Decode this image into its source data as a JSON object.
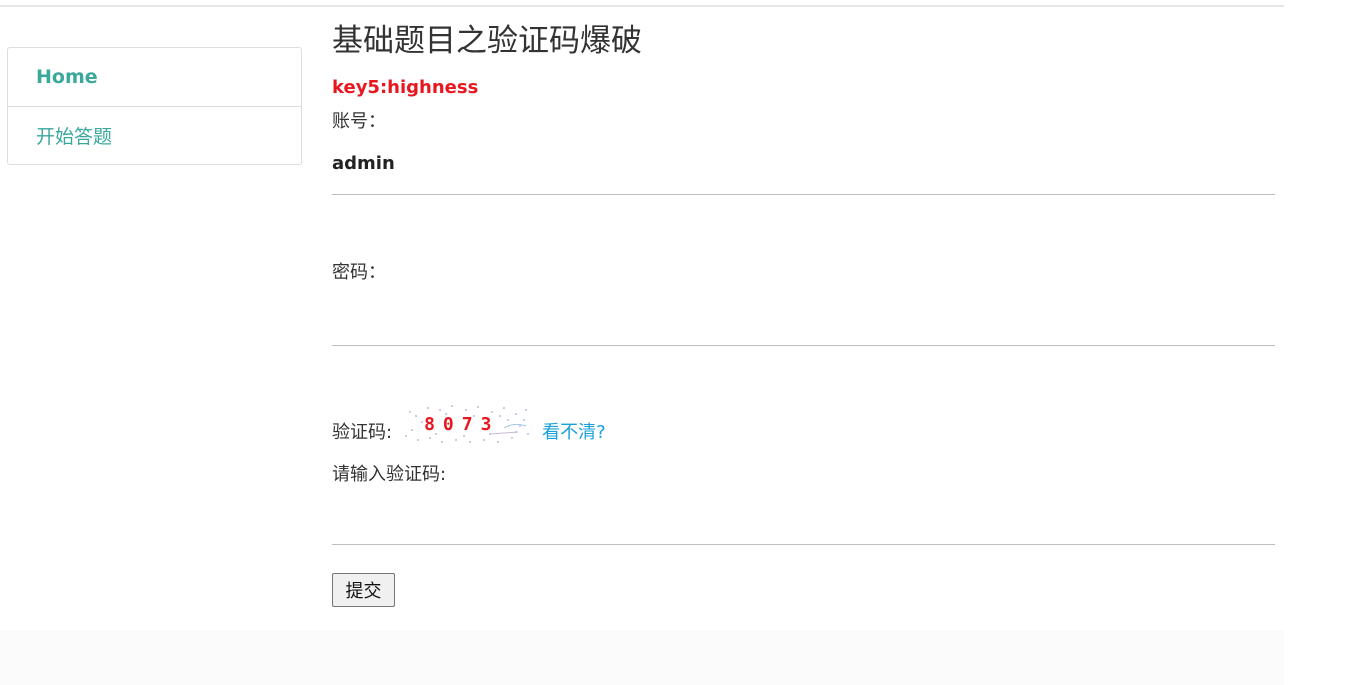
{
  "sidebar": {
    "items": [
      {
        "label": "Home"
      },
      {
        "label": "开始答题"
      }
    ]
  },
  "main": {
    "title": "基础题目之验证码爆破",
    "key_text": "key5:highness",
    "username_label": "账号：",
    "username_value": "admin",
    "password_label": "密码：",
    "captcha_label": "验证码:",
    "captcha_text": "8073",
    "refresh_label": "看不清?",
    "captcha_input_label": "请输入验证码:",
    "submit_label": "提交"
  },
  "colors": {
    "accent": "#3aa89c",
    "key": "#e8171f",
    "link": "#1a9fd9"
  }
}
